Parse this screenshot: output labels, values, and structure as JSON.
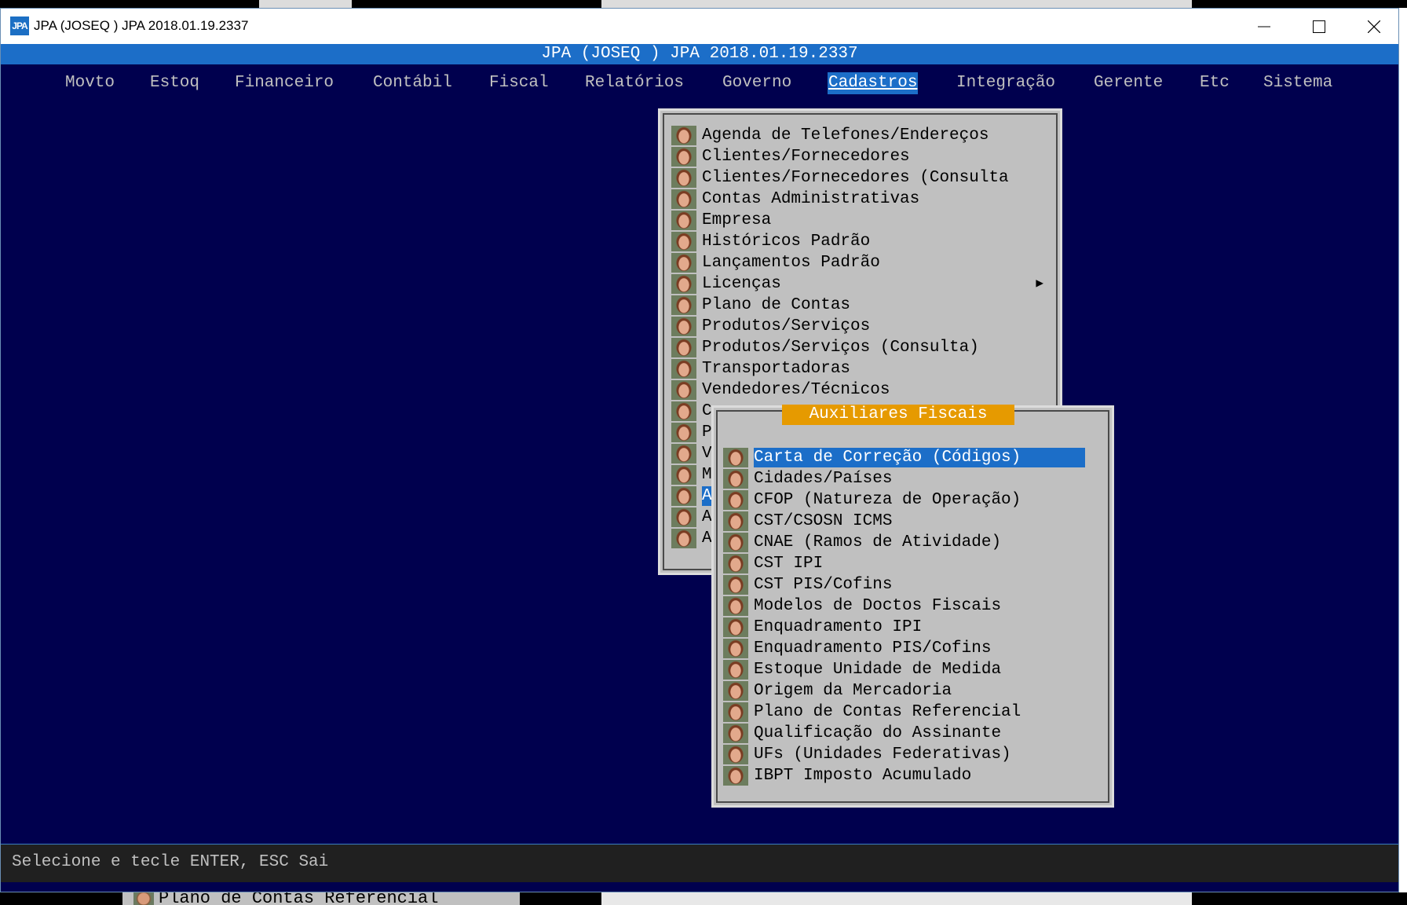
{
  "window": {
    "title": "JPA (JOSEQ ) JPA 2018.01.19.2337",
    "logo_text": "JPA"
  },
  "terminal": {
    "title": "JPA (JOSEQ ) JPA 2018.01.19.2337",
    "menu": [
      "Movto",
      "Estoq",
      "Financeiro",
      "Contábil",
      "Fiscal",
      "Relatórios",
      "Governo",
      "Cadastros",
      "Integração",
      "Gerente",
      "Etc",
      "Sistema"
    ],
    "active_menu": "Cadastros"
  },
  "cadastros_menu": {
    "items": [
      "Agenda de Telefones/Endereços",
      "Clientes/Fornecedores",
      "Clientes/Fornecedores (Consulta",
      "Contas Administrativas",
      "Empresa",
      "Históricos Padrão",
      "Lançamentos Padrão",
      "Licenças",
      "Plano de Contas",
      "Produtos/Serviços",
      "Produtos/Serviços (Consulta)",
      "Transportadoras",
      "Vendedores/Técnicos",
      "C",
      "P",
      "V",
      "M",
      "A",
      "A",
      "A"
    ],
    "submenu_arrow": "▶"
  },
  "auxiliares_menu": {
    "title": "Auxiliares Fiscais",
    "items": [
      "Carta de Correção (Códigos)",
      "Cidades/Países",
      "CFOP (Natureza de Operação)",
      "CST/CSOSN ICMS",
      "CNAE (Ramos de Atividade)",
      "CST IPI",
      "CST PIS/Cofins",
      "Modelos de Doctos Fiscais",
      "Enquadramento IPI",
      "Enquadramento PIS/Cofins",
      "Estoque Unidade de Medida",
      "Origem da Mercadoria",
      "Plano de Contas Referencial",
      "Qualificação do Assinante",
      "UFs (Unidades Federativas)",
      "IBPT Imposto Acumulado"
    ],
    "selected": "Carta de Correção (Códigos)"
  },
  "status_bar": {
    "text": "Selecione e tecle ENTER, ESC Sai"
  },
  "background_window": {
    "peek_text": "Plano de Contas Referencial"
  }
}
